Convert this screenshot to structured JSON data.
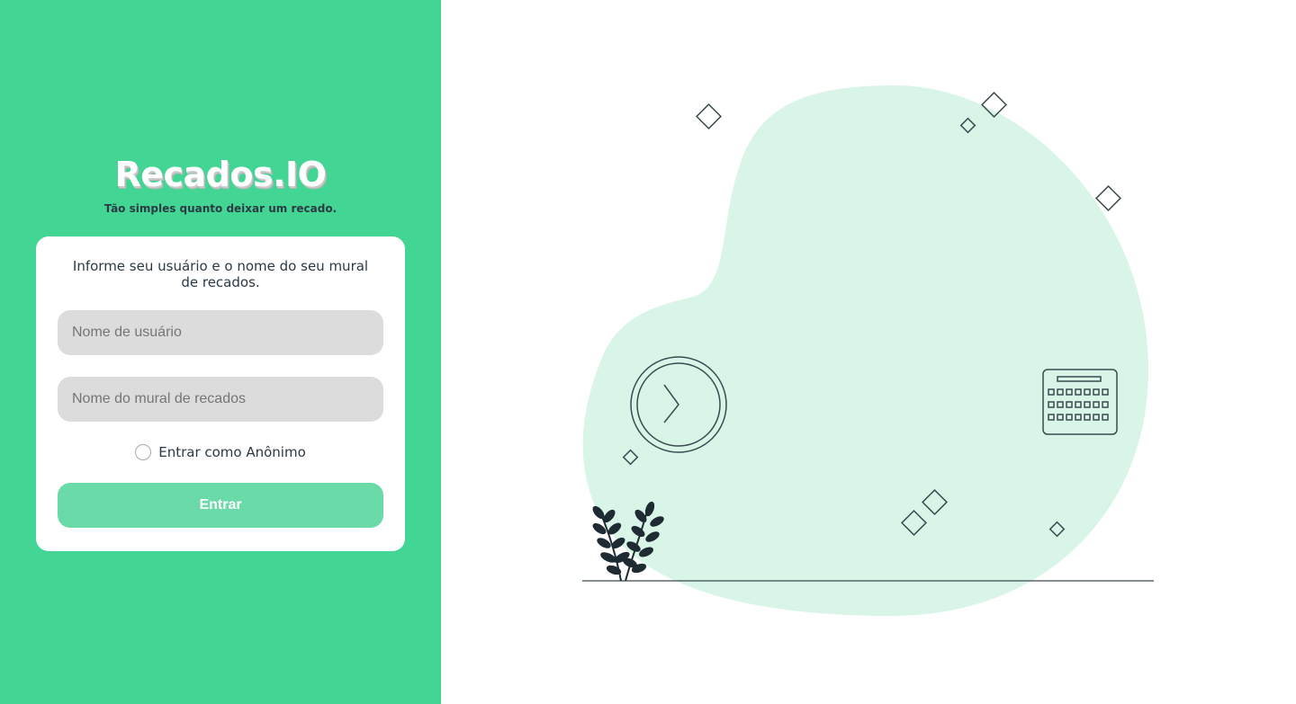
{
  "brand": {
    "title": "Recados.IO",
    "tagline": "Tão simples quanto deixar um recado."
  },
  "login_card": {
    "instructions": "Informe seu usuário e o nome do seu mural de recados.",
    "username_placeholder": "Nome de usuário",
    "mural_placeholder": "Nome do mural de recados",
    "anonymous_label": "Entrar como Anônimo",
    "anonymous_checked": false,
    "submit_label": "Entrar"
  },
  "colors": {
    "primary": "#43d594",
    "button": "#6adaa8",
    "input_bg": "#dcdcdc",
    "text_dark": "#2b3a44",
    "blob": "#d9f5e8",
    "line": "#3a4a4f"
  },
  "icons": {
    "clock": "clock-icon",
    "calendar": "calendar-icon",
    "plant": "plant-icon",
    "diamond": "diamond-icon"
  }
}
